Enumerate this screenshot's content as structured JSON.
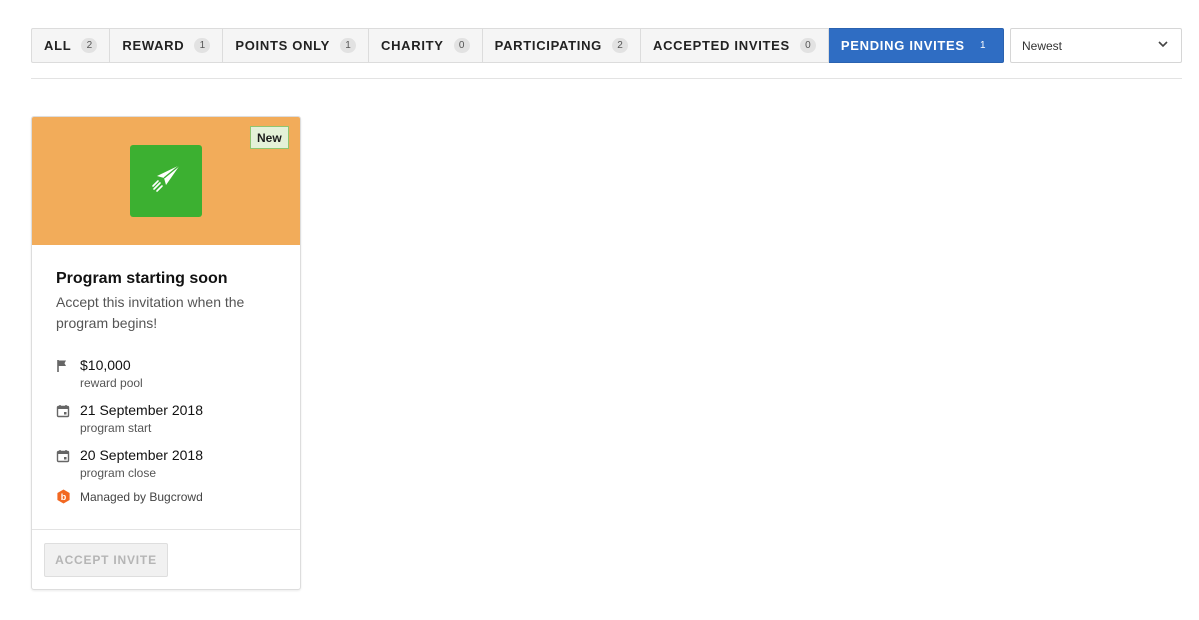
{
  "tabs": [
    {
      "label": "ALL",
      "count": "2"
    },
    {
      "label": "REWARD",
      "count": "1"
    },
    {
      "label": "POINTS ONLY",
      "count": "1"
    },
    {
      "label": "CHARITY",
      "count": "0"
    },
    {
      "label": "PARTICIPATING",
      "count": "2"
    },
    {
      "label": "ACCEPTED INVITES",
      "count": "0"
    },
    {
      "label": "PENDING INVITES",
      "count": "1",
      "active": true
    }
  ],
  "sort": {
    "selected": "Newest",
    "icon": "chevron-down-icon"
  },
  "card": {
    "badge": "New",
    "banner_color": "#f2ac5a",
    "logo_color": "#3cb031",
    "logo_icon": "paper-plane-icon",
    "title": "Program starting soon",
    "description": "Accept this invitation when the program begins!",
    "reward": {
      "value": "$10,000",
      "label": "reward pool",
      "icon": "flag-icon"
    },
    "start": {
      "value": "21 September 2018",
      "label": "program start",
      "icon": "calendar-icon"
    },
    "close": {
      "value": "20 September 2018",
      "label": "program close",
      "icon": "calendar-icon"
    },
    "managed_by": "Managed by Bugcrowd",
    "managed_icon": "bugcrowd-logo-icon",
    "accept_label": "ACCEPT INVITE"
  },
  "colors": {
    "active_tab": "#2f6dc3",
    "bugcrowd_orange": "#f26822"
  }
}
